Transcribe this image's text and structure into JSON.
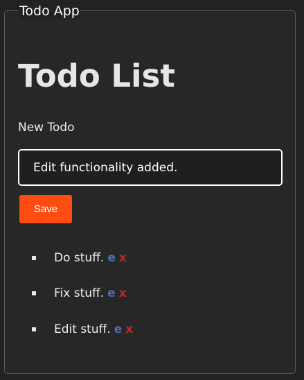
{
  "app": {
    "legend": "Todo App"
  },
  "main": {
    "title": "Todo List",
    "input_label": "New Todo",
    "input_value": "Edit functionality added.",
    "save_label": "Save"
  },
  "todos": [
    {
      "text": "Do stuff.",
      "edit": "e",
      "delete": "x"
    },
    {
      "text": "Fix stuff.",
      "edit": "e",
      "delete": "x"
    },
    {
      "text": "Edit stuff.",
      "edit": "e",
      "delete": "x"
    }
  ],
  "colors": {
    "background": "#222222",
    "panel_border": "#5a5a5a",
    "save_button": "#ff4c11",
    "edit_link": "#4f6fb3",
    "delete_link": "#b32c2c"
  }
}
